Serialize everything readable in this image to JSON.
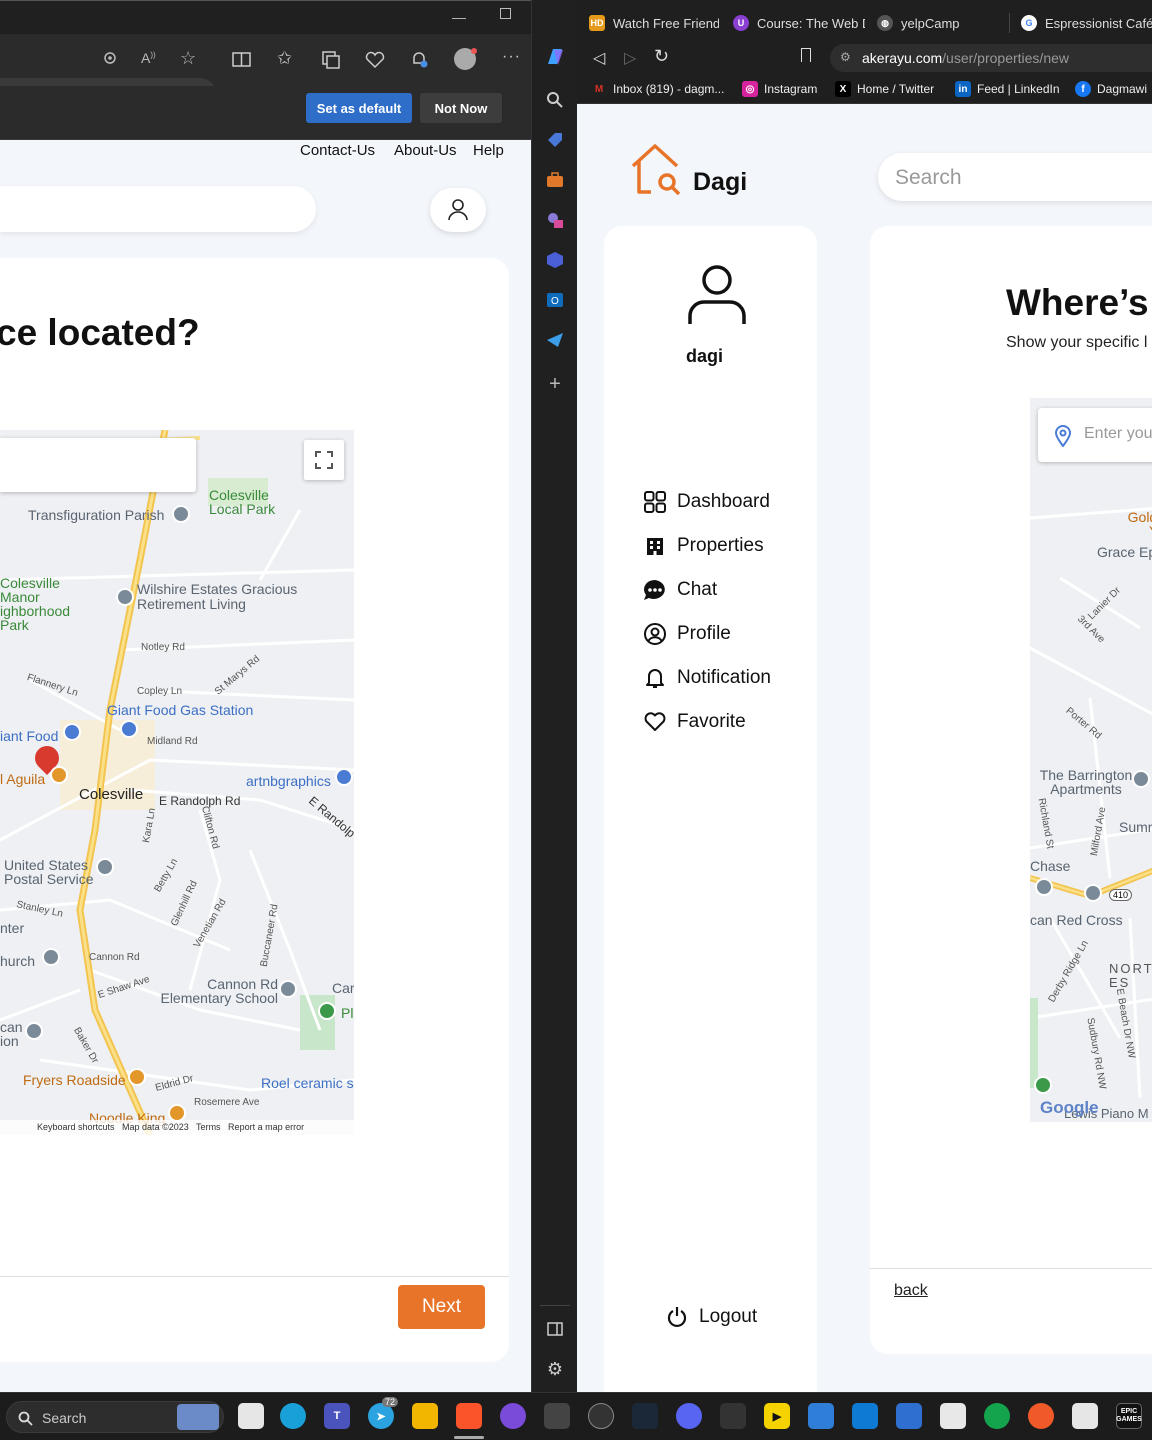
{
  "left_window": {
    "edge_buttons": {
      "set_default": "Set as default",
      "not_now": "Not Now"
    },
    "nav_links": [
      "Contact-Us",
      "About-Us",
      "Help"
    ],
    "heading": "ce located?",
    "next_label": "Next",
    "map": {
      "labels": {
        "transfiguration": "Transfiguration Parish",
        "colesville_park": "Colesville Local Park",
        "colesville_manor": "Colesville Manor ighborhood Park",
        "wilshire": "Wilshire Estates Gracious Retirement Living",
        "notley": "Notley Rd",
        "st_marys": "St Marys Rd",
        "flannery": "Flannery Ln",
        "copley": "Copley Ln",
        "giant_gas": "Giant Food Gas Station",
        "giant_food": "iant Food",
        "midland": "Midland Rd",
        "aguila": "l Aguila",
        "artnb": "artnbgraphics",
        "colesville": "Colesville",
        "e_randolph": "E Randolph Rd",
        "e_randolph2": "E Randolp",
        "kara": "Kara Ln",
        "clifton": "Clifton Rd",
        "usps": "United States Postal Service",
        "betty": "Betty Ln",
        "glenhill": "Glenhill Rd",
        "venetian": "Venetian Rd",
        "buccaneer": "Buccaneer Rd",
        "stanley": "Stanley Ln",
        "inter": "nter",
        "church": "hurch",
        "cannon_rd": "Cannon Rd",
        "e_shaw": "E Shaw Ave",
        "cannon_school": "Cannon Rd Elementary School",
        "car": "Car",
        "pl": "Pl",
        "can_ion": "can ion",
        "baker": "Baker Dr",
        "fryers": "Fryers Roadside",
        "eldrid": "Eldrid Dr",
        "roel": "Roel ceramic s",
        "rosemere": "Rosemere Ave",
        "noodle": "Noodle King",
        "footer": "Keyboard shortcuts   Map data ©2023   Terms   Report a map error"
      }
    }
  },
  "right_window": {
    "tabs": [
      {
        "label": "Watch Free Friends:",
        "icon": "HD",
        "color": "#e69a1a"
      },
      {
        "label": "Course: The Web De",
        "icon": "U",
        "color": "#8a3fd1"
      },
      {
        "label": "yelpCamp",
        "icon": "globe-icon",
        "color": "#555555"
      },
      {
        "label": "Espressionist Café s",
        "icon": "G",
        "color": "#ffffff"
      }
    ],
    "url_domain": "akerayu.com",
    "url_path": "/user/properties/new",
    "bookmarks": [
      {
        "label": "Inbox (819) - dagm...",
        "icon": "M",
        "color": "#d93025"
      },
      {
        "label": "Instagram",
        "icon": "ig",
        "color": "#d6249f"
      },
      {
        "label": "Home / Twitter",
        "icon": "X",
        "color": "#000000"
      },
      {
        "label": "Feed | LinkedIn",
        "icon": "in",
        "color": "#0a66c2"
      },
      {
        "label": "Dagmawi",
        "icon": "f",
        "color": "#1877f2"
      }
    ],
    "brand": "Dagi",
    "search_placeholder": "Search",
    "username": "dagi",
    "menu": [
      "Dashboard",
      "Properties",
      "Chat",
      "Profile",
      "Notification",
      "Favorite"
    ],
    "logout": "Logout",
    "heading": "Where’s",
    "subheading": "Show your specific l",
    "location_placeholder": "Enter you",
    "back": "back",
    "map": {
      "labels": {
        "goldb": "Goldb Yo",
        "grace": "Grace Ep",
        "lanier": "Lanier Dr",
        "third": "3rd Ave",
        "porter": "Porter Rd",
        "barrington": "The Barrington Apartments",
        "richland": "Richland St",
        "milford": "Milford Ave",
        "summ": "Summ",
        "chase": "Chase",
        "route": "410",
        "redcross": "can Red Cross",
        "derby": "Derby Ridge Ln",
        "north": "NORT ES",
        "sudbury": "Sudbury Rd NW",
        "ebeach": "E Beach Dr NW",
        "piano": "Lewis Piano M",
        "google": "Google"
      }
    }
  },
  "taskbar": {
    "search": "Search",
    "telegram_badge": "72",
    "epic_label": "EPIC GAMES"
  }
}
